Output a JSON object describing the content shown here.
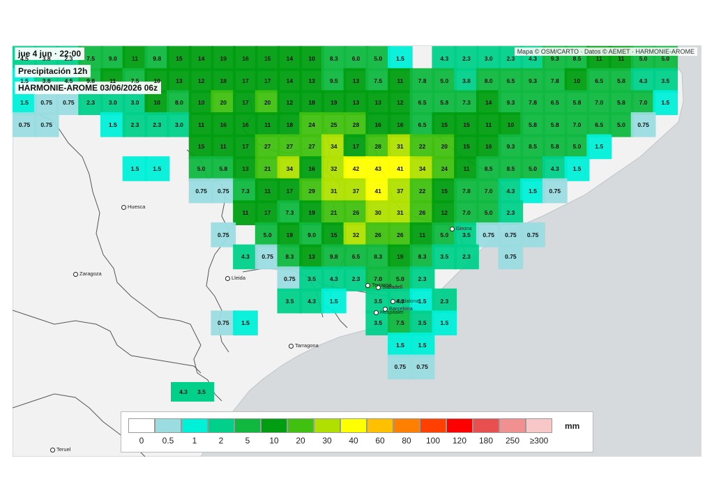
{
  "header": {
    "datetime": "jue 4 jun · 22:00",
    "variable": "Precipitación 12h",
    "model": "HARMONIE-AROME 03/06/2026 06z"
  },
  "attribution": "Mapa © OSM/CARTO · Datos © AEMET · HARMONIE-AROME",
  "legend": {
    "unit": "mm",
    "classes": [
      {
        "label": "0",
        "color": "#ffffff"
      },
      {
        "label": "0.5",
        "color": "#9adce0"
      },
      {
        "label": "1",
        "color": "#00f0d8"
      },
      {
        "label": "2",
        "color": "#00d08a"
      },
      {
        "label": "5",
        "color": "#10b840"
      },
      {
        "label": "10",
        "color": "#009e10"
      },
      {
        "label": "20",
        "color": "#40c010"
      },
      {
        "label": "30",
        "color": "#b0e000"
      },
      {
        "label": "40",
        "color": "#ffff00"
      },
      {
        "label": "60",
        "color": "#ffc000"
      },
      {
        "label": "80",
        "color": "#ff8000"
      },
      {
        "label": "100",
        "color": "#ff4000"
      },
      {
        "label": "120",
        "color": "#ff0000"
      },
      {
        "label": "180",
        "color": "#e85050"
      },
      {
        "label": "250",
        "color": "#f09090"
      },
      {
        "label": "≥300",
        "color": "#f8c8c8"
      }
    ]
  },
  "colors": {
    "sea": "#d6dadd",
    "land": "#f2f2f2",
    "border": "#555555"
  },
  "cities": [
    {
      "name": "Huesca",
      "id": "huesca"
    },
    {
      "name": "Zaragoza",
      "id": "zaragoza"
    },
    {
      "name": "Lleida",
      "id": "lleida"
    },
    {
      "name": "Tarragona",
      "id": "tarragona"
    },
    {
      "name": "Teruel",
      "id": "teruel"
    },
    {
      "name": "Girona",
      "id": "girona"
    },
    {
      "name": "Sabadell",
      "id": "sabadell"
    },
    {
      "name": "Terrassa",
      "id": "terrassa"
    },
    {
      "name": "Badalona",
      "id": "badalona"
    },
    {
      "name": "Barcelona",
      "id": "barcelona"
    },
    {
      "name": "Hospitalet",
      "id": "hospitalet"
    }
  ],
  "grid_rows": [
    [
      "4.5",
      "3.8",
      "2.3",
      "7.5",
      "9.0",
      "11",
      "9.8",
      "15",
      "14",
      "19",
      "16",
      "15",
      "14",
      "10",
      "8.3",
      "6.0",
      "5.0",
      "1.5",
      "",
      "4.3",
      "2.3",
      "3.0",
      "2.3",
      "4.3",
      "9.3",
      "8.5",
      "11",
      "11",
      "5.0",
      "5.0"
    ],
    [
      "1.5",
      "3.8",
      "4.5",
      "9.8",
      "11",
      "7.5",
      "10",
      "13",
      "12",
      "18",
      "17",
      "17",
      "14",
      "13",
      "9.5",
      "13",
      "7.5",
      "11",
      "7.8",
      "5.0",
      "3.8",
      "8.0",
      "6.5",
      "9.3",
      "7.8",
      "10",
      "6.5",
      "5.8",
      "4.3",
      "3.5"
    ],
    [
      "1.5",
      "0.75",
      "0.75",
      "2.3",
      "3.0",
      "3.0",
      "10",
      "8.0",
      "10",
      "20",
      "17",
      "20",
      "12",
      "18",
      "19",
      "13",
      "13",
      "12",
      "6.5",
      "5.8",
      "7.3",
      "14",
      "9.3",
      "7.8",
      "6.5",
      "5.8",
      "7.0",
      "5.8",
      "7.0",
      "1.5"
    ],
    [
      "0.75",
      "0.75",
      "",
      "",
      "1.5",
      "2.3",
      "2.3",
      "3.0",
      "11",
      "16",
      "16",
      "11",
      "18",
      "24",
      "25",
      "28",
      "16",
      "16",
      "6.5",
      "15",
      "15",
      "11",
      "10",
      "5.8",
      "5.8",
      "7.0",
      "6.5",
      "5.0",
      "0.75",
      ""
    ],
    [
      "",
      "",
      "",
      "",
      "",
      "",
      "",
      "",
      "15",
      "11",
      "17",
      "27",
      "27",
      "27",
      "34",
      "17",
      "28",
      "31",
      "22",
      "20",
      "15",
      "16",
      "9.3",
      "8.5",
      "5.8",
      "5.0",
      "1.5",
      "",
      "",
      ""
    ],
    [
      "",
      "",
      "",
      "",
      "",
      "1.5",
      "1.5",
      "",
      "5.0",
      "5.8",
      "13",
      "21",
      "34",
      "16",
      "32",
      "42",
      "43",
      "41",
      "34",
      "24",
      "11",
      "8.5",
      "8.5",
      "5.0",
      "4.3",
      "1.5",
      "",
      "",
      "",
      ""
    ],
    [
      "",
      "",
      "",
      "",
      "",
      "",
      "",
      "",
      "0.75",
      "0.75",
      "7.3",
      "11",
      "17",
      "29",
      "31",
      "37",
      "41",
      "37",
      "22",
      "15",
      "7.8",
      "7.0",
      "4.3",
      "1.5",
      "0.75",
      "",
      "",
      "",
      "",
      ""
    ],
    [
      "",
      "",
      "",
      "",
      "",
      "",
      "",
      "",
      "",
      "",
      "11",
      "17",
      "7.3",
      "19",
      "21",
      "26",
      "30",
      "31",
      "26",
      "12",
      "7.0",
      "5.0",
      "2.3",
      "",
      "",
      "",
      "",
      "",
      "",
      ""
    ],
    [
      "",
      "",
      "",
      "",
      "",
      "",
      "",
      "",
      "",
      "0.75",
      "",
      "5.0",
      "19",
      "9.0",
      "15",
      "32",
      "26",
      "26",
      "11",
      "5.0",
      "3.5",
      "0.75",
      "0.75",
      "0.75",
      "",
      "",
      "",
      "",
      "",
      ""
    ],
    [
      "",
      "",
      "",
      "",
      "",
      "",
      "",
      "",
      "",
      "",
      "4.3",
      "0.75",
      "8.3",
      "13",
      "9.8",
      "6.5",
      "8.3",
      "19",
      "8.3",
      "3.5",
      "2.3",
      "",
      "0.75",
      "",
      "",
      "",
      "",
      "",
      "",
      ""
    ],
    [
      "",
      "",
      "",
      "",
      "",
      "",
      "",
      "",
      "",
      "",
      "",
      "",
      "0.75",
      "3.5",
      "4.3",
      "2.3",
      "7.0",
      "5.0",
      "2.3",
      "",
      "",
      "",
      "",
      "",
      "",
      "",
      "",
      "",
      "",
      ""
    ],
    [
      "",
      "",
      "",
      "",
      "",
      "",
      "",
      "",
      "",
      "",
      "",
      "",
      "3.5",
      "4.3",
      "1.5",
      "",
      "3.5",
      "4.3",
      "1.5",
      "2.3",
      "",
      "",
      "",
      "",
      "",
      "",
      "",
      "",
      "",
      ""
    ],
    [
      "",
      "",
      "",
      "",
      "",
      "",
      "",
      "",
      "",
      "0.75",
      "1.5",
      "",
      "",
      "",
      "",
      "",
      "3.5",
      "7.5",
      "3.5",
      "1.5",
      "",
      "",
      "",
      "",
      "",
      "",
      "",
      "",
      "",
      ""
    ],
    [
      "",
      "",
      "",
      "",
      "",
      "",
      "",
      "",
      "",
      "",
      "",
      "",
      "",
      "",
      "",
      "",
      "",
      "1.5",
      "1.5",
      "",
      "",
      "",
      "",
      "",
      "",
      "",
      "",
      "",
      "",
      ""
    ],
    [
      "",
      "",
      "",
      "",
      "",
      "",
      "",
      "",
      "",
      "",
      "",
      "",
      "",
      "",
      "",
      "",
      "",
      "0.75",
      "0.75",
      "",
      "",
      "",
      "",
      "",
      "",
      "",
      "",
      "",
      "",
      ""
    ]
  ],
  "extra_values": [
    "4.3",
    "3.5"
  ]
}
